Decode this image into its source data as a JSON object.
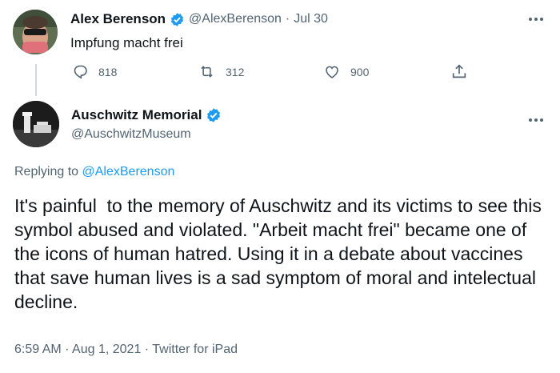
{
  "tweet1": {
    "name": "Alex Berenson",
    "handle": "@AlexBerenson",
    "separator": "·",
    "date": "Jul 30",
    "text": "Impfung macht frei",
    "replies": "818",
    "retweets": "312",
    "likes": "900"
  },
  "tweet2": {
    "name": "Auschwitz Memorial",
    "handle": "@AuschwitzMuseum",
    "replying_prefix": "Replying to",
    "replying_to": "@AlexBerenson",
    "text": "It's painful  to the memory of Auschwitz and its victims to see this symbol abused and violated. \"Arbeit macht frei\" became one of the icons of human hatred. Using it in a debate about vaccines that save human lives is a sad symptom of moral and intelectual decline.",
    "time": "6:59 AM",
    "separator": "·",
    "date": "Aug 1, 2021",
    "source": "Twitter for iPad"
  },
  "colors": {
    "accent": "#1d9bf0",
    "muted": "#536471",
    "text": "#0f1419"
  },
  "icons": [
    "reply-icon",
    "retweet-icon",
    "like-icon",
    "share-icon",
    "verified-badge-icon",
    "more-icon"
  ]
}
